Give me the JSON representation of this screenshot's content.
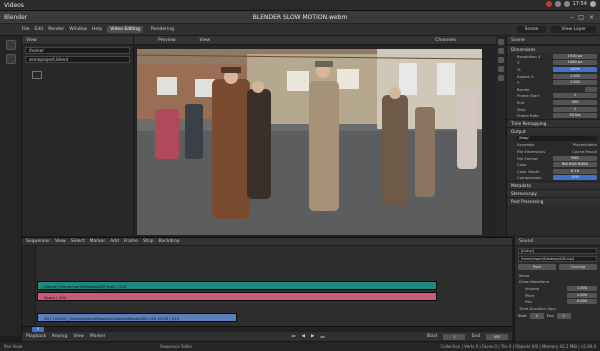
{
  "topbar": {
    "app_name": "Videos",
    "clock": "",
    "tray_time": "17:54"
  },
  "window": {
    "app_title": "Blender",
    "document_title": "BLENDER SLOW MOTION.webm"
  },
  "menu": {
    "items": [
      "File",
      "Edit",
      "Render",
      "Window",
      "Help"
    ],
    "tabs": [
      "Video Editing",
      "Rendering"
    ],
    "active_tab": "Video Editing",
    "scene_label": "Scene",
    "view_layer_label": "View Layer"
  },
  "file_panel": {
    "header_items": [
      "View"
    ],
    "path": "/home/",
    "file": "someproject.blend"
  },
  "preview": {
    "header_left": "Preview",
    "header_mid": "View",
    "channels": "Channels"
  },
  "props": {
    "scene_label": "Scene",
    "dimensions_label": "Dimensions",
    "rows": [
      {
        "label": "Resolution X",
        "value": "1920 px"
      },
      {
        "label": "Y",
        "value": "1080 px"
      },
      {
        "label": "%",
        "value": "100%"
      },
      {
        "label": "Aspect X",
        "value": "1.000"
      },
      {
        "label": "Y",
        "value": "1.000"
      },
      {
        "label": "Border",
        "value": ""
      },
      {
        "label": "Frame Start",
        "value": "1"
      },
      {
        "label": "End",
        "value": "450"
      },
      {
        "label": "Step",
        "value": "1"
      },
      {
        "label": "Frame Rate",
        "value": "30 fps"
      }
    ],
    "time_stretching": "Time Remapping",
    "output_label": "Output",
    "output_path": "/tmp/",
    "output_rows": [
      {
        "label": "Saveable",
        "value": "Placeholders"
      },
      {
        "label": "File Extensions",
        "value": "Cache Result"
      },
      {
        "label": "File Format",
        "value": "PNG"
      },
      {
        "label": "Color",
        "value": "BW  RGB  RGBA"
      },
      {
        "label": "Color Depth",
        "value": "8  16"
      },
      {
        "label": "Compression",
        "value": "15%"
      }
    ],
    "metadata_label": "Metadata",
    "stereoscopy_label": "Stereoscopy",
    "postprocessing_label": "Post Processing"
  },
  "sequencer": {
    "header_items": [
      "Sequencer",
      "View",
      "Select",
      "Marker",
      "Add",
      "Frame",
      "Strip",
      "Backdrop"
    ],
    "strips": [
      {
        "label": "[Kutvp] /home/rspm/Desktop/DR.mp3 | 210",
        "color": "#1e8a7f"
      },
      {
        "label": "Spare | 450",
        "color": "#c75a7d"
      },
      {
        "label": "001 | 00:00 | /home/rspm/Videos/Un-Videos/Movie/000-210 Of VS | 210",
        "color": "#5b7fb8"
      }
    ],
    "playhead_frame": "0"
  },
  "bottombar": {
    "items": [
      "Playback",
      "Keying",
      "View",
      "Marker"
    ],
    "start_label": "Start",
    "end_label": "End",
    "start": "1",
    "end": "450"
  },
  "statusbar": {
    "left": "Pan View",
    "mid": "Sequence Slider",
    "right": "Collection | Verts 0 | Faces 0 | Tris 0 | Objects 0/0 | Memory 42.2 MiB | v2.90.0"
  },
  "sound": {
    "header": "Sound",
    "name": "[Kutvp]",
    "file": "/home/rspm/Desktop/DR.mp3",
    "buttons": [
      "Pack",
      "Caching"
    ],
    "options": [
      "Mono",
      "Draw Waveform"
    ],
    "rows": [
      {
        "label": "Volume",
        "value": "1.000"
      },
      {
        "label": "Pitch",
        "value": "1.000"
      },
      {
        "label": "Pan",
        "value": "0.000"
      }
    ],
    "time_label": "Time Duration (fps)",
    "start_label": "Start",
    "start": "0",
    "end_label": "End",
    "end": "0"
  },
  "colors": {
    "accent": "#3f72c9",
    "strip_audio": "#1e8a7f",
    "strip_color": "#c75a7d",
    "strip_movie": "#5b7fb8"
  }
}
